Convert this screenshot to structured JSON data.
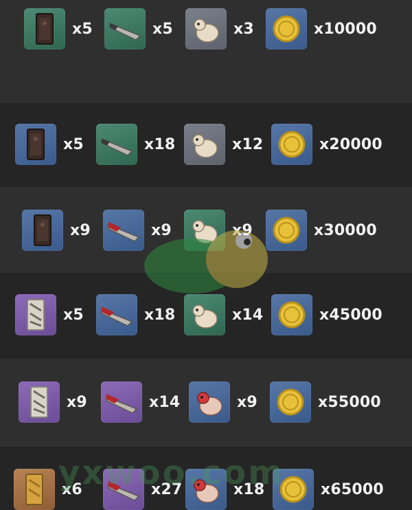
{
  "watermark": {
    "text": "yxwoo.com"
  },
  "icons": {
    "talisman_dark": "dark-talisman-icon",
    "talisman_light": "light-talisman-icon",
    "talisman_gold": "gold-talisman-icon",
    "blade_gray": "gray-blade-icon",
    "blade_red": "red-blade-icon",
    "creature_pale": "pale-creature-icon",
    "creature_red": "red-creature-icon",
    "coin": "gold-coin-icon"
  },
  "rows": [
    {
      "items": [
        {
          "icon": "talisman_dark",
          "rarity": "green",
          "qty": "x5"
        },
        {
          "icon": "blade_gray",
          "rarity": "green",
          "qty": "x5"
        },
        {
          "icon": "creature_pale",
          "rarity": "gray",
          "qty": "x3"
        },
        {
          "icon": "coin",
          "rarity": "blue",
          "qty": "x10000"
        }
      ]
    },
    {
      "items": [
        {
          "icon": "talisman_dark",
          "rarity": "blue",
          "qty": "x5"
        },
        {
          "icon": "blade_gray",
          "rarity": "green",
          "qty": "x18"
        },
        {
          "icon": "creature_pale",
          "rarity": "gray",
          "qty": "x12"
        },
        {
          "icon": "coin",
          "rarity": "blue",
          "qty": "x20000"
        }
      ]
    },
    {
      "items": [
        {
          "icon": "talisman_dark",
          "rarity": "blue",
          "qty": "x9"
        },
        {
          "icon": "blade_red",
          "rarity": "blue",
          "qty": "x9"
        },
        {
          "icon": "creature_pale",
          "rarity": "green",
          "qty": "x9"
        },
        {
          "icon": "coin",
          "rarity": "blue",
          "qty": "x30000"
        }
      ]
    },
    {
      "items": [
        {
          "icon": "talisman_light",
          "rarity": "purple",
          "qty": "x5"
        },
        {
          "icon": "blade_red",
          "rarity": "blue",
          "qty": "x18"
        },
        {
          "icon": "creature_pale",
          "rarity": "green",
          "qty": "x14"
        },
        {
          "icon": "coin",
          "rarity": "blue",
          "qty": "x45000"
        }
      ]
    },
    {
      "items": [
        {
          "icon": "talisman_light",
          "rarity": "purple",
          "qty": "x9"
        },
        {
          "icon": "blade_red",
          "rarity": "purple",
          "qty": "x14"
        },
        {
          "icon": "creature_red",
          "rarity": "blue",
          "qty": "x9"
        },
        {
          "icon": "coin",
          "rarity": "blue",
          "qty": "x55000"
        }
      ]
    },
    {
      "items": [
        {
          "icon": "talisman_gold",
          "rarity": "gold",
          "qty": "x6"
        },
        {
          "icon": "blade_red",
          "rarity": "purple",
          "qty": "x27"
        },
        {
          "icon": "creature_red",
          "rarity": "blue",
          "qty": "x18"
        },
        {
          "icon": "coin",
          "rarity": "blue",
          "qty": "x65000"
        }
      ]
    }
  ]
}
